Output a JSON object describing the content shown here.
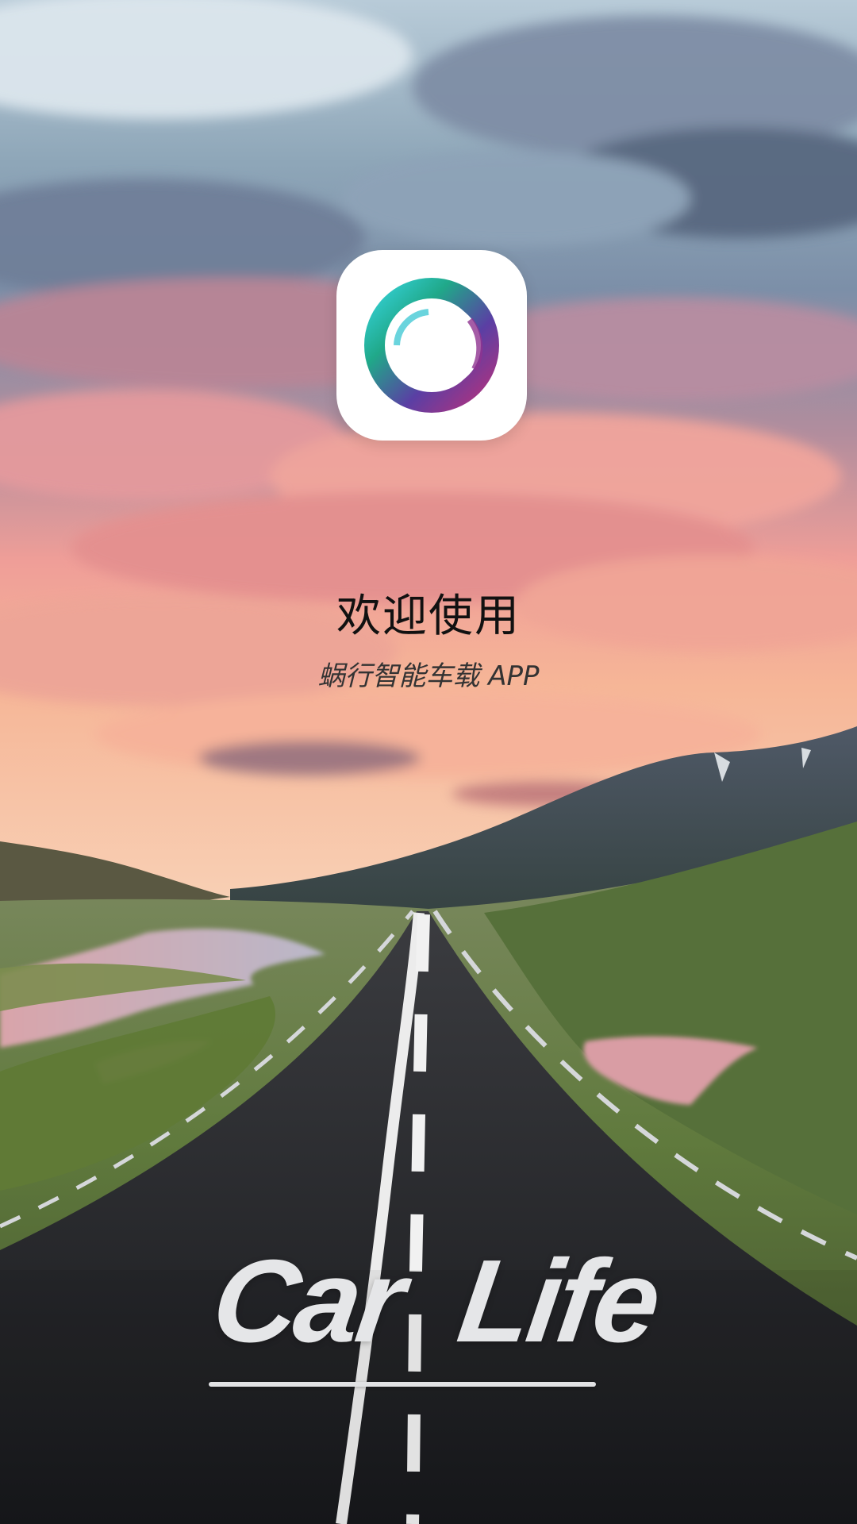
{
  "welcome": {
    "title": "欢迎使用",
    "subtitle": "蜗行智能车载 APP"
  },
  "brand": {
    "word_1": "Car",
    "word_2": "Life"
  },
  "colors": {
    "sky_top": "#7e95a8",
    "sunset_pink": "#ef9e98",
    "sunset_orange": "#f3b38b",
    "grass": "#5f7740",
    "road": "#232426",
    "title_text": "#111111",
    "brand_text": "#e5e6e8"
  },
  "icons": {
    "app_icon": "circular-ring-logo"
  }
}
